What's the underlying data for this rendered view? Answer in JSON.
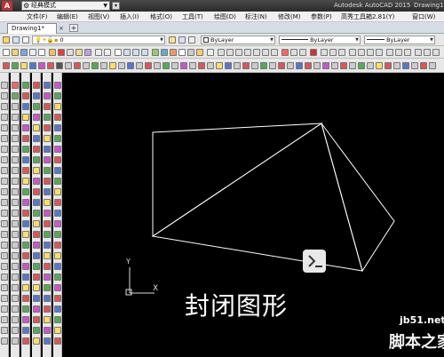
{
  "title_bar": {
    "app_icon": "A",
    "workspace": "经典模式",
    "app_title": "Autodesk AutoCAD 2015",
    "doc_title": "Drawing1"
  },
  "menu": {
    "items": [
      "文件(F)",
      "编辑(E)",
      "视图(V)",
      "插入(I)",
      "格式(O)",
      "工具(T)",
      "绘图(D)",
      "标注(N)",
      "修改(M)",
      "参数(P)",
      "高秀工具箱2.81(Y)",
      "窗口(W)"
    ]
  },
  "tabs": {
    "active": "Drawing1*",
    "close": "×",
    "new": "+"
  },
  "layers_toolbar": {
    "layer_value": "0",
    "color_value": "ByLayer",
    "linetype_value": "ByLayer",
    "lineweight_value": "ByLayer"
  },
  "canvas": {
    "caption": "封闭图形",
    "ucs_x": "X",
    "ucs_y": "Y",
    "background": "#000000",
    "line_color": "#ffffff"
  },
  "watermark": {
    "site": "jb51.net",
    "name": "脚本之家"
  }
}
